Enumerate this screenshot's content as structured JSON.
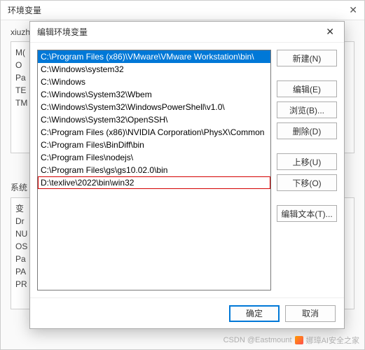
{
  "bg": {
    "title": "环境变量",
    "upper_label": "xiuzh",
    "upper_items": [
      "M(",
      "O",
      "Pa",
      "TE",
      "TM"
    ],
    "lower_label": "系统",
    "lower_items": [
      "变",
      "Dr",
      "NU",
      "OS",
      "Pa",
      "PA",
      "PR"
    ]
  },
  "dialog": {
    "title": "编辑环境变量",
    "buttons": {
      "new": "新建(N)",
      "edit": "编辑(E)",
      "browse": "浏览(B)...",
      "delete": "删除(D)",
      "moveup": "上移(U)",
      "movedown": "下移(O)",
      "edittext": "编辑文本(T)...",
      "ok": "确定",
      "cancel": "取消"
    },
    "items": [
      {
        "text": "C:\\Program Files (x86)\\VMware\\VMware Workstation\\bin\\",
        "selected": true
      },
      {
        "text": "C:\\Windows\\system32"
      },
      {
        "text": "C:\\Windows"
      },
      {
        "text": "C:\\Windows\\System32\\Wbem"
      },
      {
        "text": "C:\\Windows\\System32\\WindowsPowerShell\\v1.0\\"
      },
      {
        "text": "C:\\Windows\\System32\\OpenSSH\\"
      },
      {
        "text": "C:\\Program Files (x86)\\NVIDIA Corporation\\PhysX\\Common"
      },
      {
        "text": "C:\\Program Files\\BinDiff\\bin"
      },
      {
        "text": "C:\\Program Files\\nodejs\\"
      },
      {
        "text": "C:\\Program Files\\gs\\gs10.02.0\\bin"
      },
      {
        "text": "D:\\texlive\\2022\\bin\\win32",
        "highlighted": true
      }
    ]
  },
  "watermark": {
    "text1": "CSDN @Eastmount",
    "text2": "娜璋AI安全之家"
  }
}
